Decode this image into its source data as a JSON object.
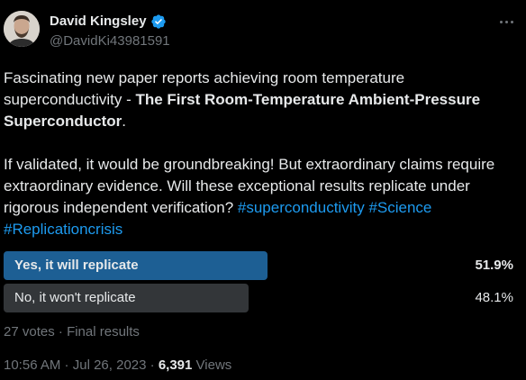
{
  "author": {
    "name": "David Kingsley",
    "handle": "@DavidKi43981591",
    "verified_color": "#1d9bf0"
  },
  "tweet": {
    "line1_prefix": "Fascinating new paper reports achieving room temperature superconductivity - ",
    "line1_bold": "The First Room-Temperature Ambient-Pressure Superconductor",
    "line1_suffix": ".",
    "line2": "If validated, it would be groundbreaking! But extraordinary claims require extraordinary evidence. Will these exceptional results replicate under rigorous independent verification? ",
    "hashtags": [
      "#superconductivity",
      "#Science",
      "#Replicationcrisis"
    ]
  },
  "poll": {
    "options": [
      {
        "label": "Yes, it will replicate",
        "percent": "51.9%",
        "fraction": 0.519,
        "winner": true,
        "color": "#1d5f94"
      },
      {
        "label": "No, it won't replicate",
        "percent": "48.1%",
        "fraction": 0.481,
        "winner": false,
        "color": "#333639"
      }
    ],
    "votes": "27 votes",
    "status": "Final results"
  },
  "meta": {
    "time": "10:56 AM",
    "date": "Jul 26, 2023",
    "views_count": "6,391",
    "views_label": "Views"
  },
  "icons": {
    "more": "more-icon",
    "verified": "verified-badge-icon"
  }
}
